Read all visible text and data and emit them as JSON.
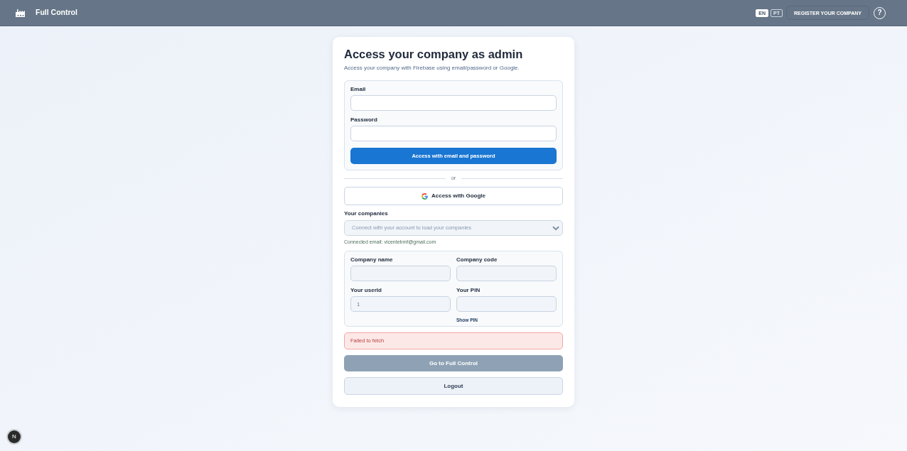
{
  "header": {
    "app_name": "Full Control",
    "languages": [
      {
        "label": "EN",
        "selected": true
      },
      {
        "label": "PT",
        "selected": false
      }
    ],
    "register_button": "REGISTER YOUR COMPANY",
    "help_button": "?"
  },
  "login_card": {
    "title": "Access your company as admin",
    "subtitle": "Access your company with Firebase using email/password or Google.",
    "email_form": {
      "fields": [
        {
          "label": "Email"
        },
        {
          "label": "Password"
        }
      ],
      "submit_button": "Access with email and password"
    },
    "divider_text": "or",
    "google_button": "Access with Google",
    "companies": {
      "label": "Your companies",
      "placeholder": "Connect with your account to load your companies",
      "disabled": true
    },
    "connected_email": "Connected email: vicentebmf@gmail.com",
    "company_form": {
      "fields": [
        {
          "label": "Company name",
          "disabled": true
        },
        {
          "label": "Company code",
          "disabled": true
        },
        {
          "label": "Your userId",
          "value": "1",
          "disabled": true
        },
        {
          "label": "Your PIN",
          "disabled": true
        }
      ],
      "show_pin_link": "Show PIN"
    },
    "error_message": "Failed to fetch",
    "go_button": {
      "label": "Go to Full Control",
      "disabled": true
    },
    "logout_button": "Logout"
  },
  "dev_indicator": "N"
}
